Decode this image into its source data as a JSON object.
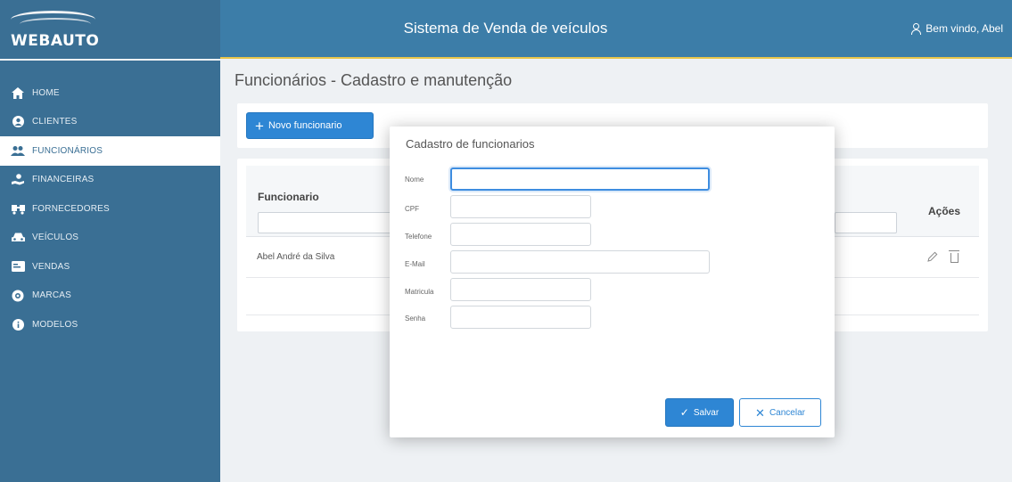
{
  "header": {
    "logo_text": "WEBAUTO",
    "title": "Sistema de Venda de veículos",
    "welcome": "Bem vindo, Abel"
  },
  "sidebar": {
    "items": [
      {
        "label": "HOME",
        "icon": "home-icon"
      },
      {
        "label": "CLIENTES",
        "icon": "user-circle-icon"
      },
      {
        "label": "FUNCIONÁRIOS",
        "icon": "users-icon",
        "active": true
      },
      {
        "label": "FINANCEIRAS",
        "icon": "hand-money-icon"
      },
      {
        "label": "FORNECEDORES",
        "icon": "truck-icon"
      },
      {
        "label": "VEÍCULOS",
        "icon": "car-icon"
      },
      {
        "label": "VENDAS",
        "icon": "card-icon"
      },
      {
        "label": "MARCAS",
        "icon": "badge-icon"
      },
      {
        "label": "MODELOS",
        "icon": "info-circle-icon"
      }
    ]
  },
  "main": {
    "page_title": "Funcionários - Cadastro e manutenção",
    "new_button": "Novo funcionario",
    "table": {
      "columns": [
        "Funcionario",
        "Ações"
      ],
      "rows": [
        {
          "name": "Abel André da Silva"
        }
      ]
    }
  },
  "dialog": {
    "title": "Cadastro de funcionarios",
    "fields": [
      {
        "label": "Nome",
        "value": ""
      },
      {
        "label": "CPF",
        "value": ""
      },
      {
        "label": "Telefone",
        "value": ""
      },
      {
        "label": "E-Mail",
        "value": ""
      },
      {
        "label": "Matricula",
        "value": ""
      },
      {
        "label": "Senha",
        "value": ""
      }
    ],
    "save_label": "Salvar",
    "cancel_label": "Cancelar"
  },
  "colors": {
    "header": "#3c7da8",
    "sidebar": "#3a6f94",
    "primary": "#2e86d4",
    "accent_line": "#e8c54a"
  }
}
